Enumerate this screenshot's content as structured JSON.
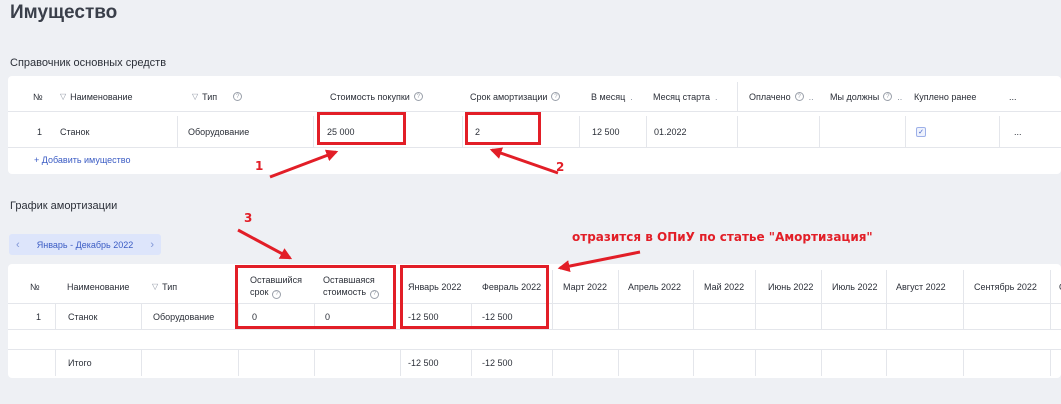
{
  "page_title": "Имущество",
  "assets": {
    "section_title": "Справочник основных средств",
    "columns": {
      "num": "№",
      "name": "Наименование",
      "type": "Тип",
      "purchase_cost": "Стоимость покупки",
      "amort_period": "Срок амортизации",
      "per_month": "В месяц",
      "start_month": "Месяц старта",
      "paid": "Оплачено",
      "we_owe": "Мы должны",
      "bought_earlier": "Куплено ранее",
      "more": "..."
    },
    "rows": [
      {
        "num": "1",
        "name": "Станок",
        "type": "Оборудование",
        "purchase_cost": "25 000",
        "amort_period": "2",
        "per_month": "12 500",
        "start_month": "01.2022",
        "paid": "",
        "we_owe": "",
        "bought_earlier": true,
        "more": "..."
      }
    ],
    "add_link": "+ Добавить имущество"
  },
  "schedule": {
    "section_title": "График амортизации",
    "period": {
      "label": "Январь - Декабрь 2022",
      "prev": "‹",
      "next": "›"
    },
    "columns": {
      "num": "№",
      "name": "Наименование",
      "type": "Тип",
      "remaining_term_1": "Оставшийся",
      "remaining_term_2": "срок",
      "remaining_cost_1": "Оставшаяся",
      "remaining_cost_2": "стоимость",
      "months": [
        "Январь 2022",
        "Февраль 2022",
        "Март 2022",
        "Апрель 2022",
        "Май 2022",
        "Июнь 2022",
        "Июль 2022",
        "Август 2022",
        "Сентябрь 2022",
        "О"
      ]
    },
    "rows": [
      {
        "num": "1",
        "name": "Станок",
        "type": "Оборудование",
        "remaining_term": "0",
        "remaining_cost": "0",
        "months": [
          "-12 500",
          "-12 500",
          "",
          "",
          "",
          "",
          "",
          "",
          "",
          ""
        ]
      }
    ],
    "total": {
      "label": "Итого",
      "months": [
        "-12 500",
        "-12 500",
        "",
        "",
        "",
        "",
        "",
        "",
        "",
        ""
      ]
    }
  },
  "annotations": {
    "n1": "1",
    "n2": "2",
    "n3": "3",
    "note": "отразится в ОПиУ по статье \"Амортизация\""
  },
  "colors": {
    "accent": "#3b5cc4",
    "annotation": "#e21e27",
    "background": "#eef0f4"
  }
}
